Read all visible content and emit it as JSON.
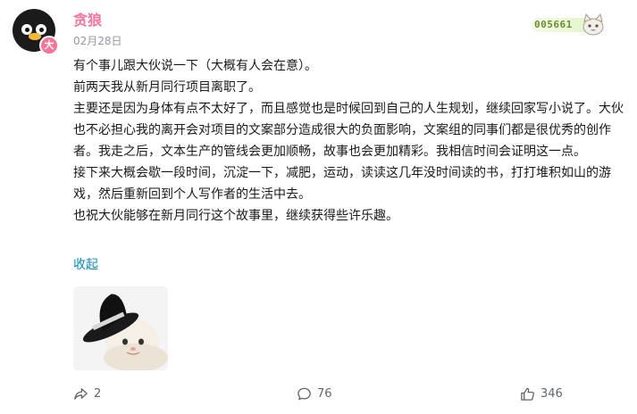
{
  "post": {
    "author": "贪狼",
    "author_badge": "大",
    "date": "02月28日",
    "fan_medal_number": "005661",
    "paragraphs": [
      "有个事儿跟大伙说一下（大概有人会在意）。",
      "前两天我从新月同行项目离职了。",
      "主要还是因为身体有点不太好了，而且感觉也是时候回到自己的人生规划，继续回家写小说了。大伙也不必担心我的离开会对项目的文案部分造成很大的负面影响，文案组的同事们都是很优秀的创作者。我走之后，文本生产的管线会更加顺畅，故事也会更加精彩。我相信时间会证明这一点。",
      "接下来大概会歇一段时间，沉淀一下，减肥，运动，读读这几年没时间读的书，打打堆积如山的游戏，然后重新回到个人写作者的生活中去。",
      "也祝大伙能够在新月同行这个故事里，继续获得些许乐趣。"
    ],
    "collapse_label": "收起"
  },
  "actions": {
    "share_count": "2",
    "comment_count": "76",
    "like_count": "346"
  },
  "colors": {
    "username": "#fb7299",
    "link": "#008ac5",
    "muted": "#9499a0"
  }
}
